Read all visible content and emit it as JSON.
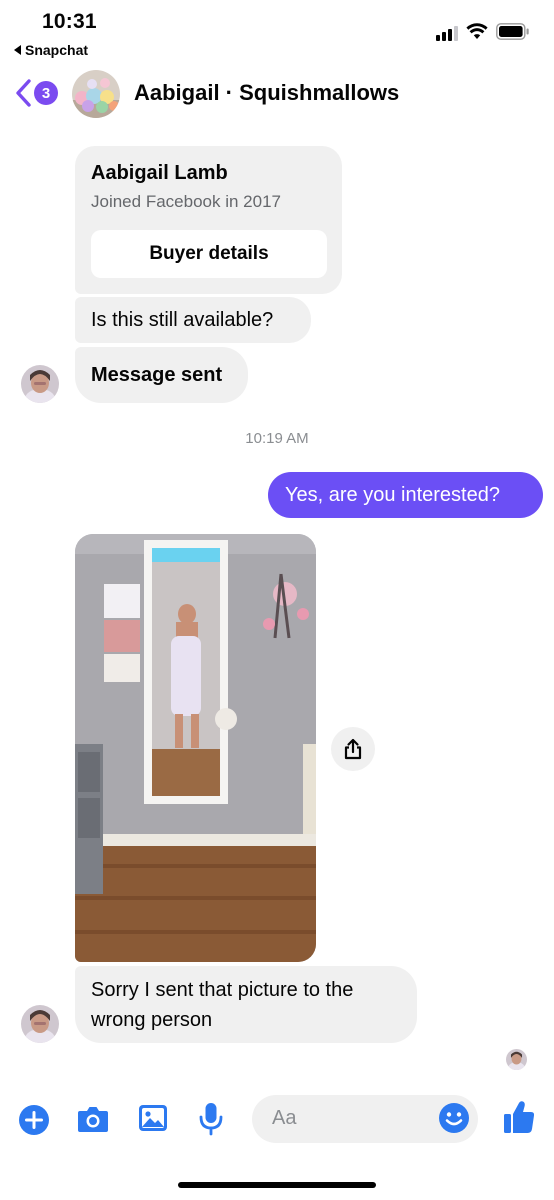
{
  "status_bar": {
    "time": "10:31",
    "back_app_label": "Snapchat",
    "signal_icon": "cell-signal-icon",
    "wifi_icon": "wifi-icon",
    "battery_icon": "battery-icon"
  },
  "header": {
    "unread_count": "3",
    "title": "Aabigail · Squishmallows",
    "back_icon": "chevron-left-icon"
  },
  "buyer_card": {
    "name": "Aabigail Lamb",
    "subtitle": "Joined Facebook in 2017",
    "button_label": "Buyer details"
  },
  "messages": [
    {
      "direction": "incoming",
      "text": "Is this still available?"
    },
    {
      "direction": "incoming",
      "text": "Message sent"
    },
    {
      "direction": "outgoing",
      "text": "Yes, are you interested?"
    },
    {
      "direction": "incoming",
      "text": "Sorry I sent that picture to the wrong person"
    }
  ],
  "timestamp": "10:19 AM",
  "composer": {
    "placeholder": "Aa",
    "icons": [
      "plus-icon",
      "camera-icon",
      "gallery-icon",
      "microphone-icon",
      "emoji-icon",
      "thumbs-up-icon"
    ]
  },
  "colors": {
    "accent_blue": "#2c79f0",
    "outgoing_bubble": "#6b4ff5",
    "badge_purple": "#7b4bf0",
    "incoming_bubble": "#f0f0f0"
  }
}
